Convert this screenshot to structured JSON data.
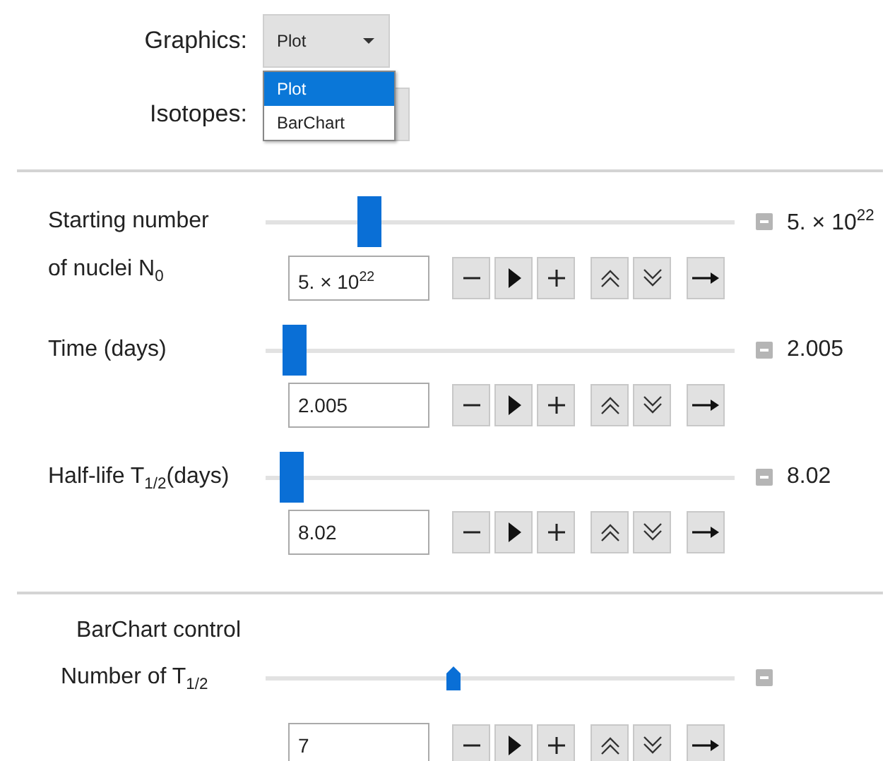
{
  "selectors": [
    {
      "label": "Graphics:",
      "value": "Plot"
    },
    {
      "label": "Isotopes:"
    }
  ],
  "dropdown": {
    "options": [
      {
        "label": "Plot",
        "selected": true
      },
      {
        "label": "BarChart",
        "selected": false
      }
    ]
  },
  "sections": [
    {
      "sliders": [
        {
          "kind": "bar",
          "label": "Starting number\nof nuclei N$_{0}$",
          "level": 0.22,
          "reading": "5. × 10$^{22}$",
          "input": "5. × 10$^{22}$"
        },
        {
          "kind": "bar",
          "label": "Time (days)",
          "level": 0.06,
          "reading": "2.005",
          "input": "2.005"
        },
        {
          "kind": "bar",
          "label": "Half-life T$_{1/2}$(days)",
          "level": 0.055,
          "reading": "8.02",
          "input": "8.02"
        }
      ]
    },
    {
      "title": "BarChart control",
      "sliders": [
        {
          "kind": "pointer",
          "label": "Number of T$_{1/2}$",
          "level": 0.4,
          "input": "7"
        }
      ]
    }
  ]
}
